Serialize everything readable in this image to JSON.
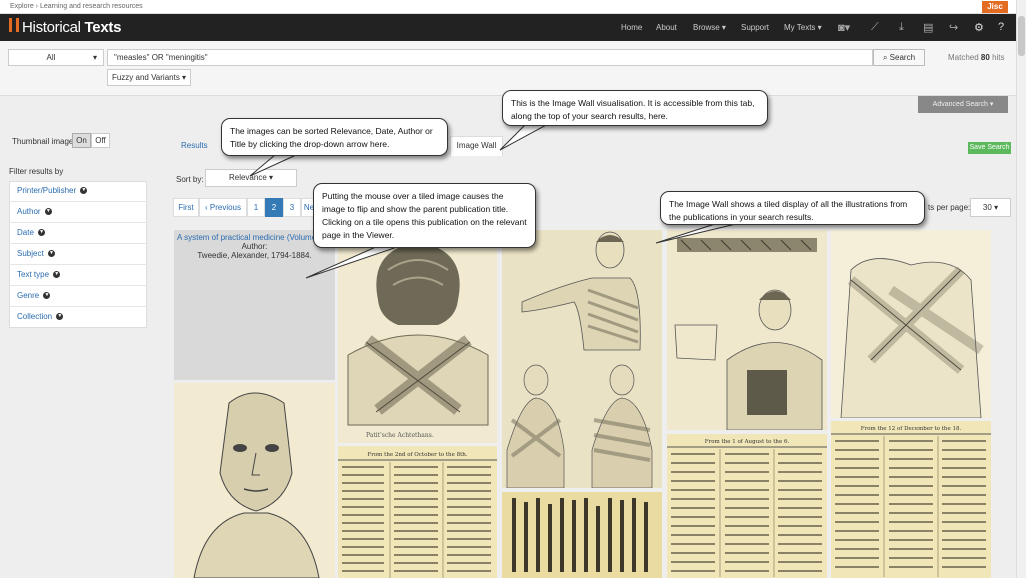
{
  "topstrip": {
    "text": "Explore › Learning and research resources",
    "logo": "Jisc"
  },
  "navbar": {
    "brand_a": "Historical ",
    "brand_b": "Texts",
    "home": "Home",
    "about": "About",
    "browse": "Browse ▾",
    "support": "Support",
    "mytexts": "My Texts ▾"
  },
  "search": {
    "scope": "All",
    "query": "\"measles\" OR \"meningitis\"",
    "button": "Search",
    "matched_label": "Matched",
    "matched_count": "80",
    "matched_unit": "hits",
    "fuzzy": "Fuzzy and Variants ▾",
    "advanced": "Advanced Search ▾"
  },
  "sidebar": {
    "thumb_label": "Thumbnail images:",
    "on": "On",
    "off": "Off",
    "filter_title": "Filter results by",
    "filters": [
      "Printer/Publisher",
      "Author",
      "Date",
      "Subject",
      "Text type",
      "Genre",
      "Collection"
    ]
  },
  "tabs": {
    "results": "Results",
    "image_wall": "Image Wall",
    "save": "Save Search"
  },
  "sort": {
    "label": "Sort by:",
    "value": "Relevance"
  },
  "pagination": {
    "first": "First",
    "prev": "‹ Previous",
    "p1": "1",
    "p2": "2",
    "p3": "3",
    "next": "Ne",
    "per_page_label": "ts per page:",
    "per_page": "30"
  },
  "tile_info": {
    "title": "A system of practical medicine (Volume 1",
    "author_label": "Author:",
    "author": "Tweedie, Alexander, 1794-1884."
  },
  "captions": {
    "back": "Patit'sche Achtethans.",
    "ledger1": "From the 2nd of October to the 8th.",
    "ledger2": "From the 1 of August to the 6.",
    "ledger3": "From the 12 of December to the 18."
  },
  "callouts": {
    "c1": "The images can be sorted Relevance, Date, Author or Title by clicking the drop-down arrow here.",
    "c2": "This is the Image Wall visualisation. It is accessible from this tab, along the top of your search results, here.",
    "c3": "Putting the mouse over a tiled image causes the image to flip and show the parent publication title. Clicking on a tile opens this publication on the relevant page in the Viewer.",
    "c4": "The Image Wall shows a tiled display of all the illustrations from the publications in your search results."
  },
  "colors": {
    "navbar": "#222222",
    "accent": "#e46c22",
    "link": "#2b6cb0",
    "save": "#5cb85c",
    "page_active": "#337ab7",
    "paper": "#f3ebc3"
  }
}
